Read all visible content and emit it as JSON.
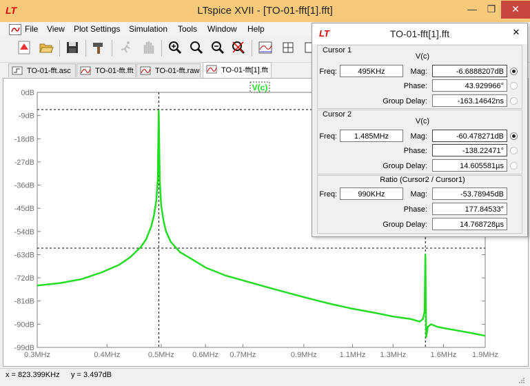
{
  "window": {
    "title": "LTspice XVII - [TO-01-fft[1].fft]",
    "min_glyph": "—",
    "max_glyph": "❐",
    "close_glyph": "✕"
  },
  "menu": [
    "File",
    "View",
    "Plot Settings",
    "Simulation",
    "Tools",
    "Window",
    "Help"
  ],
  "tabs": [
    {
      "label": "TO-01-fft.asc",
      "active": false
    },
    {
      "label": "TO-01-fft.fft",
      "active": false
    },
    {
      "label": "TO-01-fft.raw",
      "active": false
    },
    {
      "label": "TO-01-fft[1].fft",
      "active": true
    }
  ],
  "plot": {
    "trace_label": "V(c)",
    "trace_color": "#22dd22",
    "status_x": "x = 823.399KHz",
    "status_y": "y = 3.497dB"
  },
  "chart_data": {
    "type": "line",
    "x_scale": "log",
    "xlim": [
      0.3,
      1.9
    ],
    "ylim": [
      -99,
      0
    ],
    "x_ticks": [
      0.3,
      0.4,
      0.5,
      0.6,
      0.7,
      0.9,
      1.1,
      1.3,
      1.6,
      1.9
    ],
    "x_tick_labels": [
      "0.3MHz",
      "0.4MHz",
      "0.5MHz",
      "0.6MHz",
      "0.7MHz",
      "0.9MHz",
      "1.1MHz",
      "1.3MHz",
      "1.6MHz",
      "1.9MHz"
    ],
    "y_ticks": [
      0,
      -9,
      -18,
      -27,
      -36,
      -45,
      -54,
      -63,
      -72,
      -81,
      -90,
      -99
    ],
    "y_tick_labels": [
      "0dB",
      "-9dB",
      "-18dB",
      "-27dB",
      "-36dB",
      "-45dB",
      "-54dB",
      "-63dB",
      "-72dB",
      "-81dB",
      "-90dB",
      "-99dB"
    ],
    "series": [
      {
        "name": "V(c)",
        "x": [
          0.3,
          0.33,
          0.36,
          0.39,
          0.42,
          0.44,
          0.46,
          0.47,
          0.48,
          0.485,
          0.49,
          0.493,
          0.495,
          0.497,
          0.5,
          0.505,
          0.51,
          0.52,
          0.54,
          0.57,
          0.6,
          0.65,
          0.7,
          0.8,
          0.9,
          1.0,
          1.1,
          1.2,
          1.3,
          1.4,
          1.45,
          1.47,
          1.48,
          1.485,
          1.49,
          1.495,
          1.5,
          1.52,
          1.56,
          1.6,
          1.7,
          1.8,
          1.9
        ],
        "y": [
          -75,
          -74,
          -72.5,
          -70,
          -67,
          -64,
          -60,
          -57,
          -52,
          -48,
          -42,
          -34,
          -7,
          -34,
          -44,
          -50,
          -54,
          -58,
          -62,
          -65,
          -68,
          -71,
          -73,
          -76.5,
          -79.5,
          -82,
          -84,
          -85.5,
          -87,
          -88,
          -89,
          -88,
          -85,
          -63,
          -95,
          -93,
          -91,
          -90,
          -91,
          -91.5,
          -92.5,
          -93.5,
          -94.5
        ]
      }
    ],
    "cursors": [
      {
        "freq_mhz": 0.495,
        "mag_db": -6.6888207
      },
      {
        "freq_mhz": 1.485,
        "mag_db": -60.478271
      }
    ]
  },
  "dialog": {
    "title": "TO-01-fft[1].fft",
    "cursor1": {
      "heading": "Cursor 1",
      "signal": "V(c)",
      "freq_label": "Freq:",
      "freq": "495KHz",
      "mag_label": "Mag:",
      "mag": "-6.6888207dB",
      "phase_label": "Phase:",
      "phase": "43.929966°",
      "gd_label": "Group Delay:",
      "gd": "-163.14642ns"
    },
    "cursor2": {
      "heading": "Cursor 2",
      "signal": "V(c)",
      "freq_label": "Freq:",
      "freq": "1.485MHz",
      "mag_label": "Mag:",
      "mag": "-60.478271dB",
      "phase_label": "Phase:",
      "phase": "-138.22471°",
      "gd_label": "Group Delay:",
      "gd": "14.605581µs"
    },
    "ratio": {
      "heading": "Ratio (Cursor2 / Cursor1)",
      "freq_label": "Freq:",
      "freq": "990KHz",
      "mag_label": "Mag:",
      "mag": "-53.78945dB",
      "phase_label": "Phase:",
      "phase": "177.84533°",
      "gd_label": "Group Delay:",
      "gd": "14.768728µs"
    },
    "close_glyph": "✕"
  }
}
